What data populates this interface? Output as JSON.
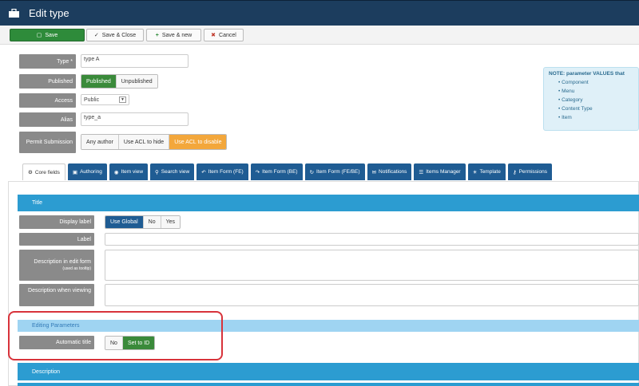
{
  "header": {
    "title": "Edit type"
  },
  "toolbar": {
    "save": "Save",
    "save_close": "Save & Close",
    "save_new": "Save & new",
    "cancel": "Cancel"
  },
  "form": {
    "type_label": "Type *",
    "type_value": "type A",
    "published_label": "Published",
    "published_options": [
      "Published",
      "Unpublished"
    ],
    "access_label": "Access",
    "access_value": "Public",
    "alias_label": "Alias",
    "alias_value": "type_a",
    "permit_label": "Permit Submission",
    "permit_options": [
      "Any author",
      "Use ACL to hide",
      "Use ACL to disable"
    ]
  },
  "note": {
    "title": "NOTE: parameter VALUES that",
    "items": [
      "Component",
      "Menu",
      "Category",
      "Content Type",
      "Item"
    ]
  },
  "tabs": [
    "Core fields",
    "Authoring",
    "Item view",
    "Search view",
    "Item Form (FE)",
    "Item Form (BE)",
    "Item Form (FE/BE)",
    "Notifications",
    "Items Manager",
    "Template",
    "Permissions"
  ],
  "panel": {
    "title_section": "Title",
    "display_label": "Display label",
    "display_options": [
      "Use Global",
      "No",
      "Yes"
    ],
    "label": "Label",
    "desc_edit": "Description in edit form",
    "desc_edit_note": "(used as tooltip)",
    "desc_view": "Description when viewing",
    "editing_params": "Editing Parameters",
    "auto_title": "Automatic title",
    "auto_options": [
      "No",
      "Set to ID"
    ],
    "description_section": "Description"
  }
}
